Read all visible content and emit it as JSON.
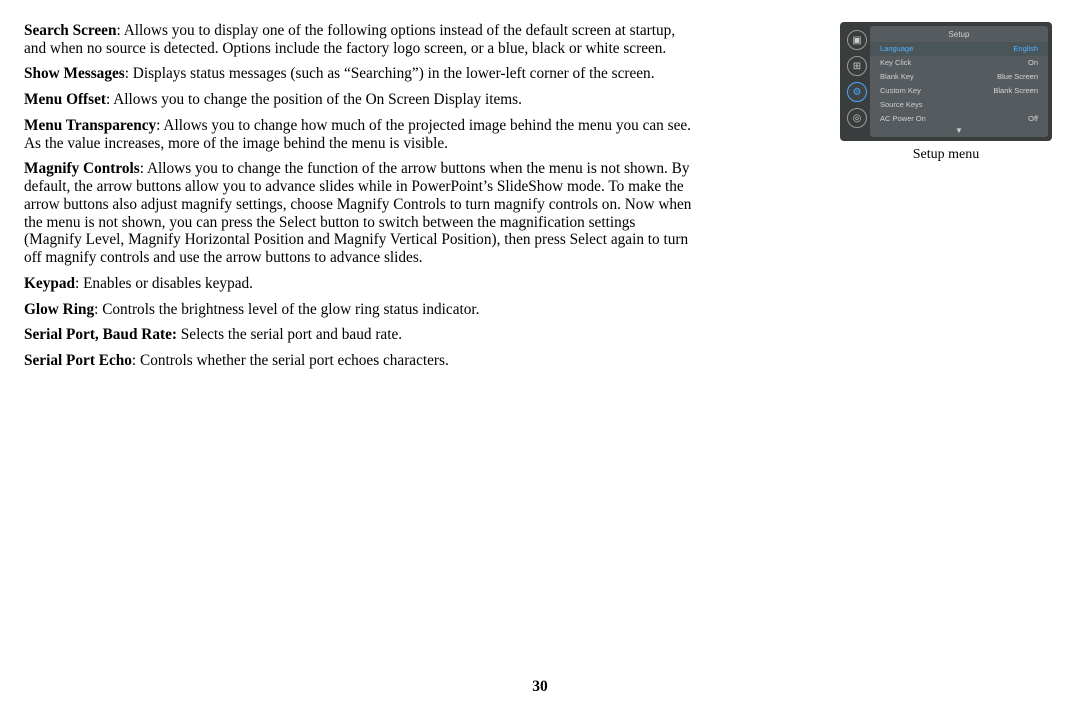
{
  "paras": [
    {
      "b": "Search Screen",
      "t": ": Allows you to display one of the following options instead of the default screen at startup, and when no source is detected. Options include the factory logo screen, or a blue, black or white screen."
    },
    {
      "b": "Show Messages",
      "t": ": Displays status messages (such as “Searching”) in the lower-left corner of the screen."
    },
    {
      "b": "Menu Offset",
      "t": ": Allows you to change the position of the On Screen Display items."
    },
    {
      "b": "Menu Transparency",
      "t": ": Allows you to change how much of the projected image behind the menu you can see. As the value increases, more of the image behind the menu is visible."
    },
    {
      "b": "Magnify Controls",
      "t": ": Allows you to change the function of the arrow buttons when the menu is not shown. By default, the arrow buttons allow you to advance slides while in PowerPoint’s SlideShow mode. To make the arrow buttons also adjust magnify settings, choose Magnify Controls to turn magnify controls on. Now when the menu is not shown, you can press the Select button to switch between the magnification settings (Magnify Level, Magnify Horizontal Position and Magnify Vertical Position), then press Select again to turn off magnify controls and use the arrow buttons to advance slides."
    },
    {
      "b": "Keypad",
      "t": ": Enables or disables keypad."
    },
    {
      "b": "Glow Ring",
      "t": ": Controls the brightness level of the glow ring status indicator."
    },
    {
      "b": "Serial Port, Baud Rate:",
      "t": " Selects the serial port and baud rate."
    },
    {
      "b": "Serial Port Echo",
      "t": ": Controls whether the serial port echoes characters."
    }
  ],
  "menu": {
    "title": "Setup",
    "items": [
      {
        "label": "Language",
        "value": "English",
        "sel": true
      },
      {
        "label": "Key Click",
        "value": "On"
      },
      {
        "label": "Blank Key",
        "value": "Blue Screen"
      },
      {
        "label": "Custom Key",
        "value": "Blank Screen"
      },
      {
        "label": "Source Keys",
        "value": ""
      },
      {
        "label": "AC Power On",
        "value": "Off"
      }
    ],
    "arrow": "▼"
  },
  "caption": "Setup menu",
  "page_number": "30",
  "icons": [
    "▣",
    "⊞",
    "⚙",
    "◎"
  ]
}
